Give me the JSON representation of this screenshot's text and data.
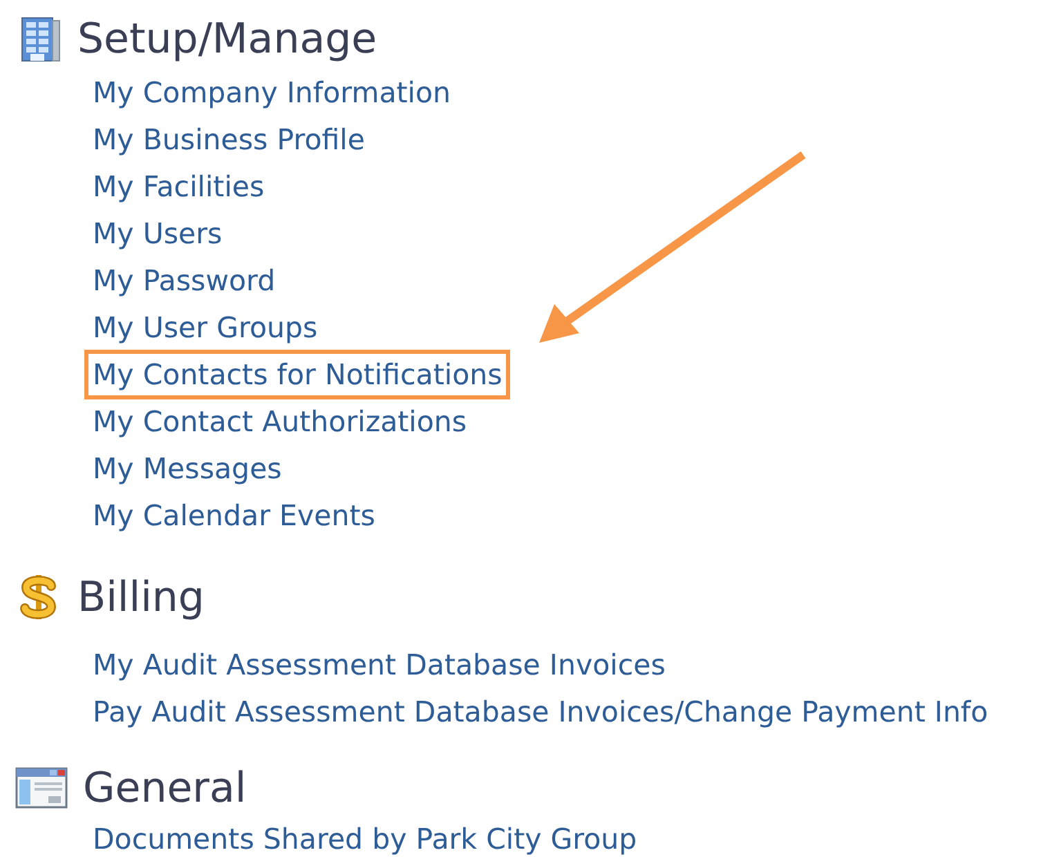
{
  "sections": [
    {
      "kind": "building",
      "title": "Setup/Manage",
      "links": [
        {
          "label": "My Company Information",
          "highlighted": false
        },
        {
          "label": "My Business Profile",
          "highlighted": false
        },
        {
          "label": "My Facilities",
          "highlighted": false
        },
        {
          "label": "My Users",
          "highlighted": false
        },
        {
          "label": "My Password",
          "highlighted": false
        },
        {
          "label": "My User Groups",
          "highlighted": false
        },
        {
          "label": "My Contacts for Notifications",
          "highlighted": true
        },
        {
          "label": "My Contact Authorizations",
          "highlighted": false
        },
        {
          "label": "My Messages",
          "highlighted": false
        },
        {
          "label": "My Calendar Events",
          "highlighted": false
        }
      ]
    },
    {
      "kind": "dollar",
      "title": "Billing",
      "links": [
        {
          "label": "My Audit Assessment Database Invoices",
          "highlighted": false
        },
        {
          "label": "Pay Audit Assessment Database Invoices/Change Payment Info",
          "highlighted": false
        }
      ]
    },
    {
      "kind": "window",
      "title": "General",
      "links": [
        {
          "label": "Documents Shared by Park City Group",
          "highlighted": false
        }
      ]
    }
  ]
}
